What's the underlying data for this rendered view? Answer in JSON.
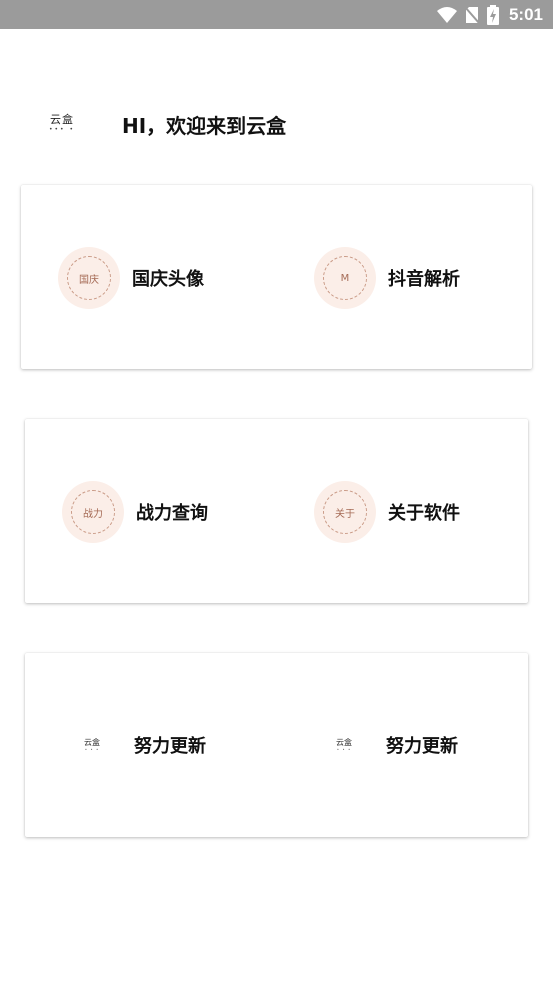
{
  "status_bar": {
    "time": "5:01",
    "icons": [
      "wifi-icon",
      "no-sim-icon",
      "battery-charging-icon"
    ]
  },
  "header": {
    "logo_text": "云盒",
    "logo_dots": "••• •",
    "greeting": "HI，欢迎来到云盒"
  },
  "cards": [
    {
      "items": [
        {
          "icon_text": "国庆",
          "label": "国庆头像"
        },
        {
          "icon_text": "M",
          "label": "抖音解析"
        }
      ]
    },
    {
      "items": [
        {
          "icon_text": "战力",
          "label": "战力查询"
        },
        {
          "icon_text": "关于",
          "label": "关于软件"
        }
      ]
    },
    {
      "items": [
        {
          "logo_text": "云盒",
          "logo_dots": "• • •",
          "label": "努力更新"
        },
        {
          "logo_text": "云盒",
          "logo_dots": "• • •",
          "label": "努力更新"
        }
      ]
    }
  ],
  "colors": {
    "status_bar": "#9b9b9b",
    "icon_circle": "#fbeee8",
    "icon_ring": "#c99a86"
  }
}
